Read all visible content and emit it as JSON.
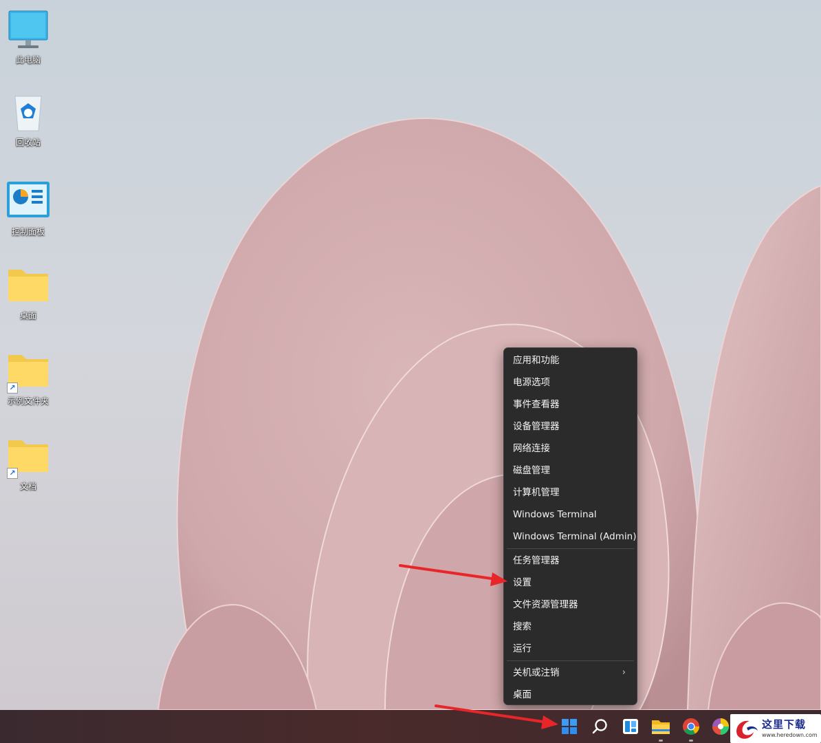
{
  "desktop": {
    "icons": [
      {
        "label": "此电脑",
        "icon": "computer-icon"
      },
      {
        "label": "回收站",
        "icon": "recycle-bin-icon"
      },
      {
        "label": "控制面板",
        "icon": "control-panel-icon"
      },
      {
        "label": "桌面",
        "icon": "folder-icon"
      },
      {
        "label": "示例文件夹",
        "icon": "folder-shortcut-icon"
      },
      {
        "label": "文档",
        "icon": "folder-shortcut-icon"
      }
    ]
  },
  "context_menu": {
    "items": [
      "应用和功能",
      "电源选项",
      "事件查看器",
      "设备管理器",
      "网络连接",
      "磁盘管理",
      "计算机管理",
      "Windows Terminal",
      "Windows Terminal (Admin)",
      "任务管理器",
      "设置",
      "文件资源管理器",
      "搜索",
      "运行",
      "关机或注销",
      "桌面"
    ],
    "submenu_chevron": "›"
  },
  "taskbar": {
    "buttons": [
      "start-icon",
      "search-icon",
      "widgets-icon",
      "file-explorer-icon",
      "chrome-icon",
      "color-app-icon"
    ]
  },
  "watermark": {
    "title": "这里下载",
    "url": "www.heredown.com"
  },
  "colors": {
    "menu_bg": "#2b2b2b",
    "annotation_arrow": "#e8262a",
    "start_blue": "#2f8ff0"
  }
}
